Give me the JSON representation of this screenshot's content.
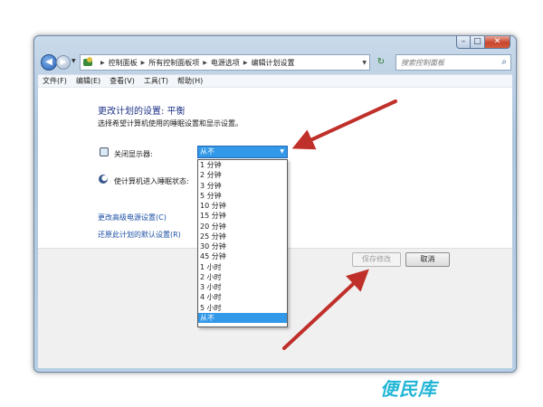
{
  "window": {
    "controls": {
      "minimize": "–",
      "maximize": "□",
      "close": "✕"
    }
  },
  "nav": {
    "back_icon": "left-arrow-icon",
    "breadcrumbs": [
      "控制面板",
      "所有控制面板项",
      "电源选项",
      "编辑计划设置"
    ],
    "search_placeholder": "搜索控制面板"
  },
  "menu": {
    "items": [
      "文件(F)",
      "编辑(E)",
      "查看(V)",
      "工具(T)",
      "帮助(H)"
    ]
  },
  "main": {
    "title": "更改计划的设置: 平衡",
    "subtitle": "选择希望计算机使用的睡眠设置和显示设置。",
    "display_off_label": "关闭显示器:",
    "sleep_label": "使计算机进入睡眠状态:",
    "display_off_selected": "从不",
    "display_off_options": [
      "1 分钟",
      "2 分钟",
      "3 分钟",
      "5 分钟",
      "10 分钟",
      "15 分钟",
      "20 分钟",
      "25 分钟",
      "30 分钟",
      "45 分钟",
      "1 小时",
      "2 小时",
      "3 小时",
      "4 小时",
      "5 小时",
      "从不"
    ],
    "advanced_link": "更改高级电源设置(C)",
    "restore_link": "还原此计划的默认设置(R)",
    "save_button": "保存修改",
    "cancel_button": "取消"
  },
  "annotations": {
    "arrow_color": "#c0302a"
  },
  "watermark": "便民库"
}
